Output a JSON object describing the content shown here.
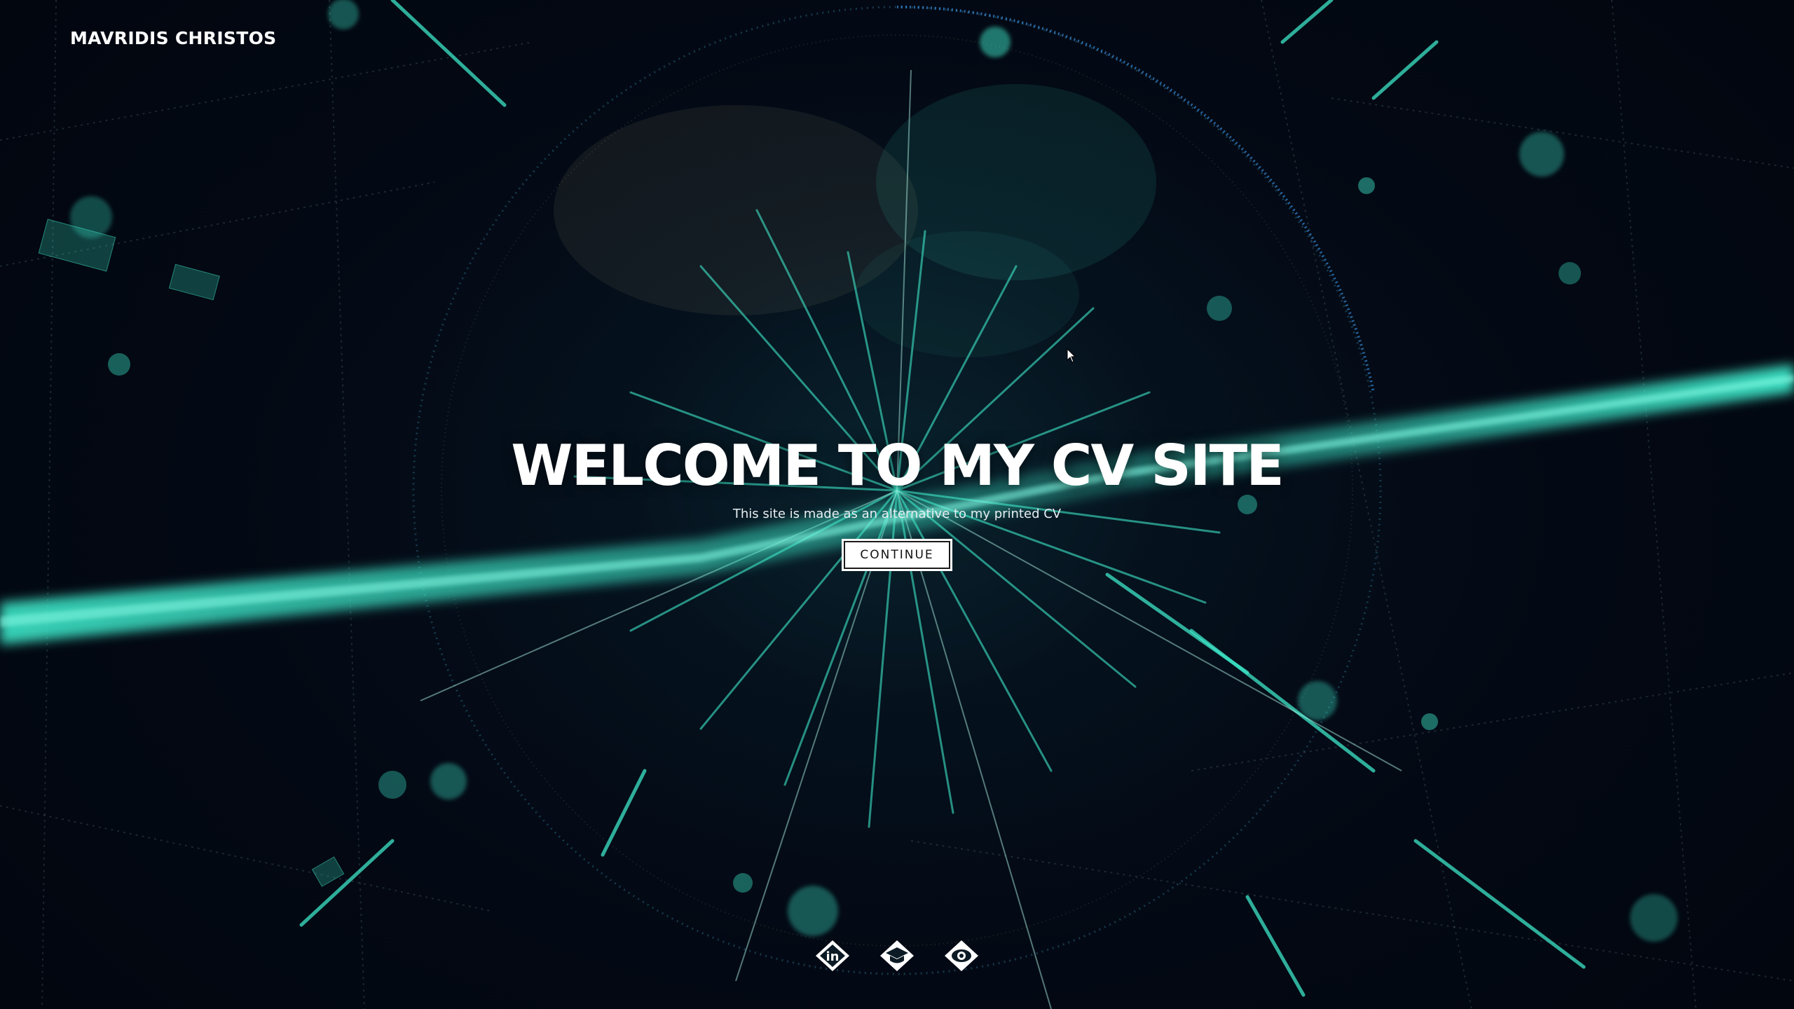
{
  "brand": {
    "name": "MAVRIDIS CHRISTOS"
  },
  "hero": {
    "title": "WELCOME TO MY CV SITE",
    "subtitle": "This site is made as an alternative to my printed CV",
    "cta_label": "CONTINUE"
  },
  "social_links": [
    {
      "icon": "linkedin-icon",
      "label": "in"
    },
    {
      "icon": "graduation-cap-icon",
      "label": ""
    },
    {
      "icon": "eye-icon",
      "label": ""
    }
  ],
  "colors": {
    "background": "#030814",
    "accent": "#3de6c8",
    "text": "#ffffff"
  }
}
